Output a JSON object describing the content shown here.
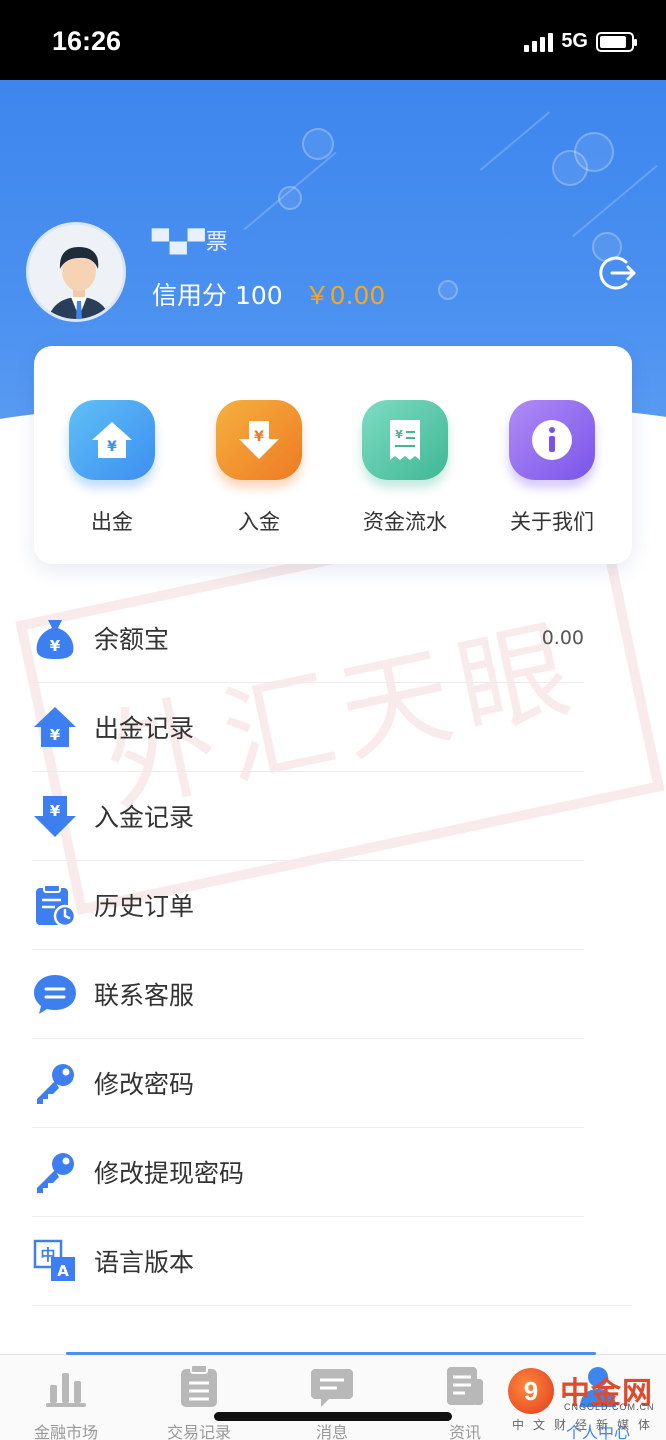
{
  "status_bar": {
    "time": "16:26",
    "network": "5G"
  },
  "profile": {
    "username": "▀▄▀票",
    "credit_label": "信用分 100",
    "balance": "￥0.00"
  },
  "quick_actions": [
    {
      "label": "出金",
      "icon": "withdraw-house-icon",
      "color": "#4aa8f0"
    },
    {
      "label": "入金",
      "icon": "deposit-arrow-icon",
      "color": "#f39a2f"
    },
    {
      "label": "资金流水",
      "icon": "receipt-icon",
      "color": "#52c7a6"
    },
    {
      "label": "关于我们",
      "icon": "info-icon",
      "color": "#8e6cf0"
    }
  ],
  "menu": [
    {
      "label": "余额宝",
      "value": "0.00",
      "icon": "money-bag-icon"
    },
    {
      "label": "出金记录",
      "value": "",
      "icon": "withdraw-record-icon"
    },
    {
      "label": "入金记录",
      "value": "",
      "icon": "deposit-record-icon"
    },
    {
      "label": "历史订单",
      "value": "",
      "icon": "history-order-icon"
    },
    {
      "label": "联系客服",
      "value": "",
      "icon": "chat-bubble-icon"
    },
    {
      "label": "修改密码",
      "value": "",
      "icon": "key-icon"
    },
    {
      "label": "修改提现密码",
      "value": "",
      "icon": "key-icon"
    },
    {
      "label": "语言版本",
      "value": "",
      "icon": "language-icon"
    }
  ],
  "bottom_nav": [
    {
      "label": "金融市场",
      "icon": "bar-chart-icon"
    },
    {
      "label": "交易记录",
      "icon": "clipboard-icon"
    },
    {
      "label": "消息",
      "icon": "message-icon"
    },
    {
      "label": "资讯",
      "icon": "news-icon"
    },
    {
      "label": "个人中心",
      "icon": "user-icon"
    }
  ],
  "watermark": {
    "stamp_text": "外汇天眼",
    "brand_name": "中金网",
    "brand_url": "CNGOLD.COM.CN",
    "brand_sub": "中文财经新媒体"
  },
  "colors": {
    "primary": "#3e86ee",
    "balance": "#f5a623"
  }
}
